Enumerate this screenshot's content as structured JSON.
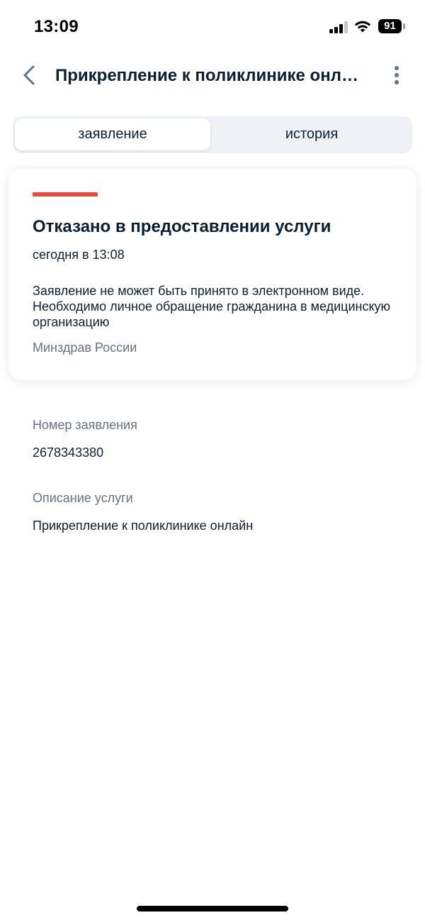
{
  "status_bar": {
    "time": "13:09",
    "battery": "91",
    "icons": [
      "signal-icon",
      "wifi-icon",
      "battery-icon"
    ]
  },
  "header": {
    "title": "Прикрепление к поликлинике онлайн",
    "back_icon": "chevron-left-icon",
    "menu_icon": "more-vertical-icon"
  },
  "tabs": [
    {
      "label": "заявление",
      "active": true
    },
    {
      "label": "история",
      "active": false
    }
  ],
  "status_card": {
    "status_color": "#e84a3c",
    "title": "Отказано в предоставлении услуги",
    "date": "сегодня в 13:08",
    "message": "Заявление не может быть принято в электронном виде. Необходимо личное обращение гражданина в медицинскую организацию",
    "organization": "Минздрав России"
  },
  "details": [
    {
      "label": "Номер заявления",
      "value": "2678343380"
    },
    {
      "label": "Описание услуги",
      "value": "Прикрепление к поликлинике онлайн"
    }
  ]
}
